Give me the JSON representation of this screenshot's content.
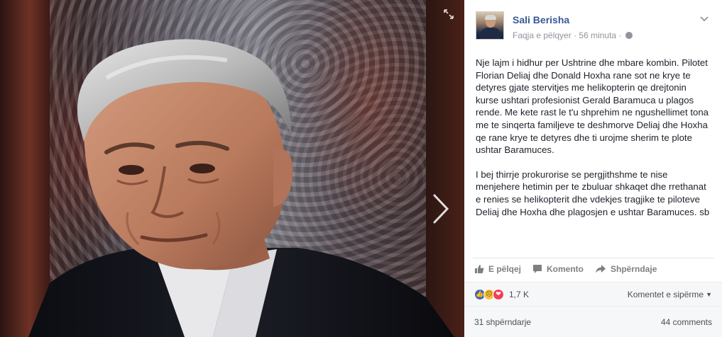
{
  "post": {
    "author": "Sali Berisha",
    "page_type": "Faqja e pëlqyer",
    "separator": "·",
    "time": "56 minuta",
    "paragraphs": [
      "Nje lajm i hidhur per Ushtrine dhe mbare kombin. Pilotet Florian Deliaj dhe Donald Hoxha rane sot ne krye te detyres gjate stervitjes me helikopterin qe drejtonin kurse ushtari profesionist Gerald Baramuca u plagos rende. Me kete rast le t'u shprehim ne ngushellimet tona me te sinqerta familjeve te deshmorve Deliaj dhe Hoxha qe rane krye te detyres dhe ti urojme sherim te plote ushtar Baramuces.",
      "I bej thirrje prokurorise se pergjithshme te nise menjehere hetimin per te zbuluar shkaqet dhe rrethanat e renies se helikopterit dhe vdekjes tragjike te piloteve Deliaj dhe Hoxha dhe plagosjen e ushtar Baramuces. sb"
    ]
  },
  "actions": {
    "like": "E pëlqej",
    "comment": "Komento",
    "share": "Shpërndaje"
  },
  "reactions": {
    "count": "1,7 K",
    "types": [
      "like",
      "sad",
      "love"
    ],
    "sort_label": "Komentet e sipërme"
  },
  "footer": {
    "shares": "31 shpërndarje",
    "comments": "44 comments"
  },
  "colors": {
    "link_blue": "#365899",
    "like_blue": "#4267b2",
    "love_red": "#f33e58",
    "sad_yellow": "#f7c23a"
  }
}
